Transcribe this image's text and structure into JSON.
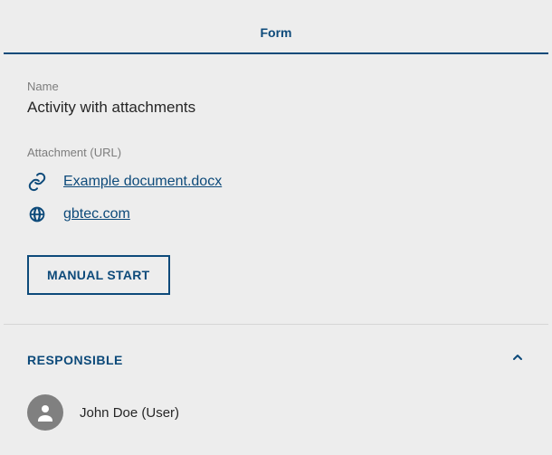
{
  "tab": {
    "title": "Form"
  },
  "fields": {
    "name_label": "Name",
    "name_value": "Activity with attachments",
    "attachment_label": "Attachment (URL)"
  },
  "attachments": [
    {
      "icon": "link-icon",
      "text": "Example document.docx"
    },
    {
      "icon": "globe-icon",
      "text": "gbtec.com"
    }
  ],
  "actions": {
    "manual_start": "MANUAL START"
  },
  "sections": {
    "responsible": {
      "title": "RESPONSIBLE",
      "expanded": true,
      "user": "John Doe (User)"
    }
  }
}
